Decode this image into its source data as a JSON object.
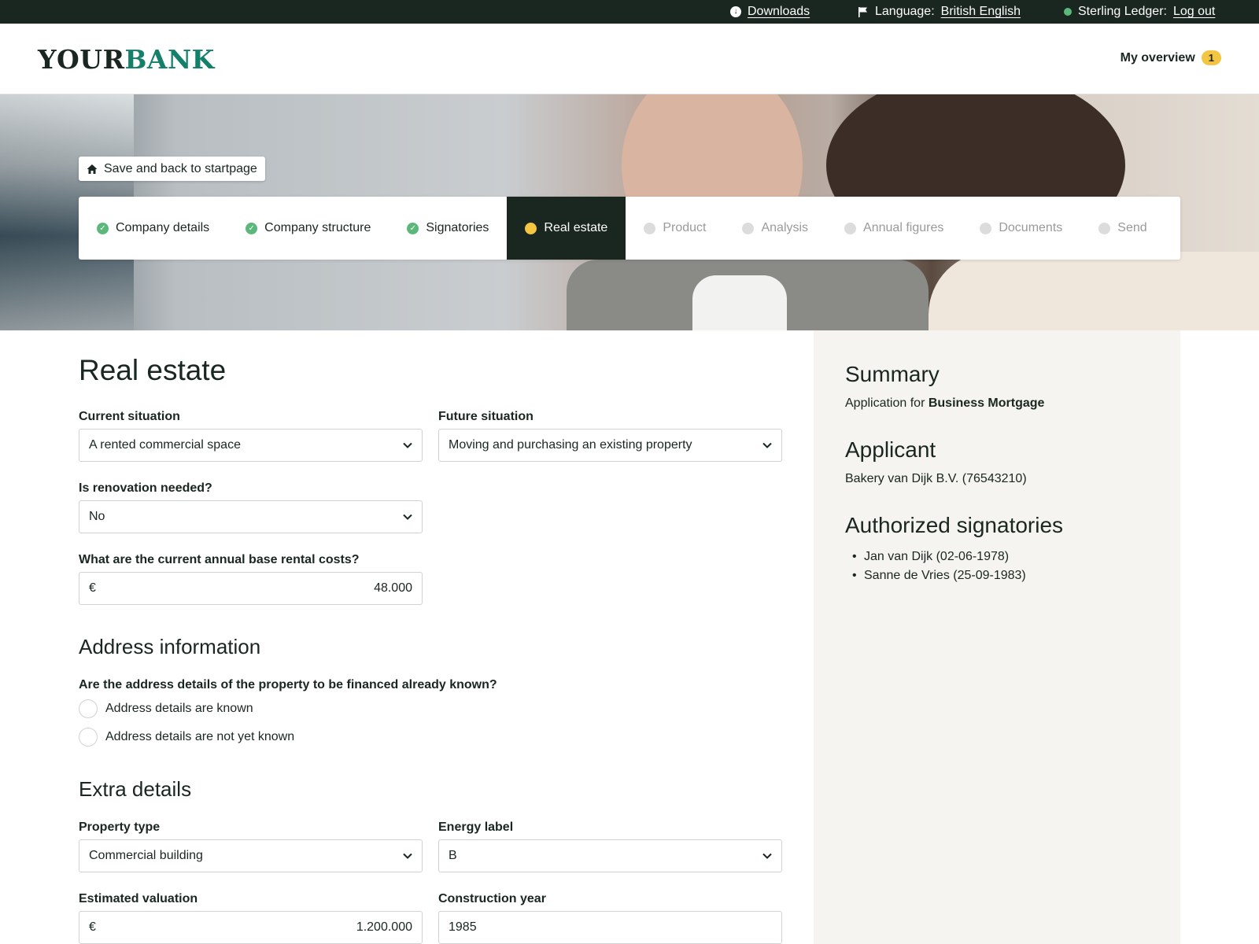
{
  "topbar": {
    "downloads": "Downloads",
    "language_label": "Language:",
    "language_value": "British English",
    "user_name": "Sterling Ledger:",
    "logout": "Log out",
    "status_color": "#5cb87a"
  },
  "header": {
    "logo_part1": "YOUR",
    "logo_part2": "BANK",
    "overview_label": "My overview",
    "overview_count": "1"
  },
  "hero": {
    "save_button": "Save and back to startpage"
  },
  "steps": [
    {
      "label": "Company details",
      "state": "done"
    },
    {
      "label": "Company structure",
      "state": "done"
    },
    {
      "label": "Signatories",
      "state": "done"
    },
    {
      "label": "Real estate",
      "state": "current"
    },
    {
      "label": "Product",
      "state": "todo"
    },
    {
      "label": "Analysis",
      "state": "todo"
    },
    {
      "label": "Annual figures",
      "state": "todo"
    },
    {
      "label": "Documents",
      "state": "todo"
    },
    {
      "label": "Send",
      "state": "todo"
    }
  ],
  "form": {
    "title": "Real estate",
    "current_situation": {
      "label": "Current situation",
      "value": "A rented commercial space"
    },
    "future_situation": {
      "label": "Future situation",
      "value": "Moving and purchasing an existing property"
    },
    "renovation": {
      "label": "Is renovation needed?",
      "value": "No"
    },
    "rental_costs": {
      "label": "What are the current annual base rental costs?",
      "currency": "€",
      "value": "48.000"
    },
    "address_section": "Address information",
    "address_question": "Are the address details of the property to be financed already known?",
    "address_options": [
      "Address details are known",
      "Address details are not yet known"
    ],
    "extra_section": "Extra details",
    "property_type": {
      "label": "Property type",
      "value": "Commercial building"
    },
    "energy_label": {
      "label": "Energy label",
      "value": "B"
    },
    "valuation": {
      "label": "Estimated valuation",
      "currency": "€",
      "value": "1.200.000"
    },
    "construction_year": {
      "label": "Construction year",
      "value": "1985"
    }
  },
  "summary": {
    "title": "Summary",
    "application_prefix": "Application for",
    "application_product": "Business Mortgage",
    "applicant_title": "Applicant",
    "applicant": "Bakery van Dijk B.V. (76543210)",
    "signatories_title": "Authorized signatories",
    "signatories": [
      "Jan van Dijk (02-06-1978)",
      "Sanne de Vries (25-09-1983)"
    ]
  }
}
